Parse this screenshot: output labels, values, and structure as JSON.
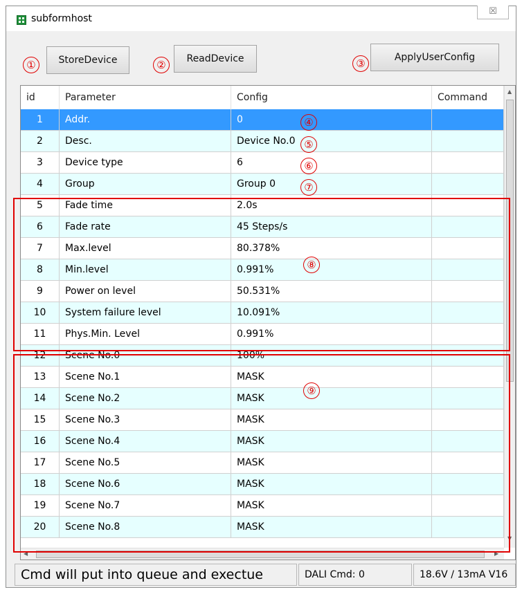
{
  "window": {
    "title": "subformhost",
    "close_glyph": "☒"
  },
  "toolbar": {
    "store_label": "StoreDevice",
    "read_label": "ReadDevice",
    "apply_label": "ApplyUserConfig"
  },
  "annotations": [
    "①",
    "②",
    "③",
    "④",
    "⑤",
    "⑥",
    "⑦",
    "⑧",
    "⑨"
  ],
  "table": {
    "headers": [
      "id",
      "Parameter",
      "Config",
      "Command"
    ],
    "rows": [
      {
        "id": "1",
        "param": "Addr.",
        "config": "0",
        "cmd": ""
      },
      {
        "id": "2",
        "param": "Desc.",
        "config": "Device No.0",
        "cmd": ""
      },
      {
        "id": "3",
        "param": "Device type",
        "config": "6",
        "cmd": ""
      },
      {
        "id": "4",
        "param": "Group",
        "config": "Group 0",
        "cmd": ""
      },
      {
        "id": "5",
        "param": "Fade time",
        "config": "2.0s",
        "cmd": ""
      },
      {
        "id": "6",
        "param": "Fade rate",
        "config": "45 Steps/s",
        "cmd": ""
      },
      {
        "id": "7",
        "param": "Max.level",
        "config": "80.378%",
        "cmd": ""
      },
      {
        "id": "8",
        "param": "Min.level",
        "config": "0.991%",
        "cmd": ""
      },
      {
        "id": "9",
        "param": "Power on level",
        "config": "50.531%",
        "cmd": ""
      },
      {
        "id": "10",
        "param": "System failure level",
        "config": "10.091%",
        "cmd": ""
      },
      {
        "id": "11",
        "param": "Phys.Min. Level",
        "config": "0.991%",
        "cmd": ""
      },
      {
        "id": "12",
        "param": "Scene No.0",
        "config": "100%",
        "cmd": ""
      },
      {
        "id": "13",
        "param": "Scene No.1",
        "config": "MASK",
        "cmd": ""
      },
      {
        "id": "14",
        "param": "Scene No.2",
        "config": "MASK",
        "cmd": ""
      },
      {
        "id": "15",
        "param": "Scene No.3",
        "config": "MASK",
        "cmd": ""
      },
      {
        "id": "16",
        "param": "Scene No.4",
        "config": "MASK",
        "cmd": ""
      },
      {
        "id": "17",
        "param": "Scene No.5",
        "config": "MASK",
        "cmd": ""
      },
      {
        "id": "18",
        "param": "Scene No.6",
        "config": "MASK",
        "cmd": ""
      },
      {
        "id": "19",
        "param": "Scene No.7",
        "config": "MASK",
        "cmd": ""
      },
      {
        "id": "20",
        "param": "Scene No.8",
        "config": "MASK",
        "cmd": ""
      }
    ]
  },
  "statusbar": {
    "message": "Cmd will put into queue and exectue",
    "dali_cmd": "DALI Cmd: 0",
    "power": "18.6V / 13mA V16"
  },
  "colors": {
    "selected_row": "#3399ff",
    "alt_row": "#e6ffff",
    "annotation_red": "#e00000"
  }
}
